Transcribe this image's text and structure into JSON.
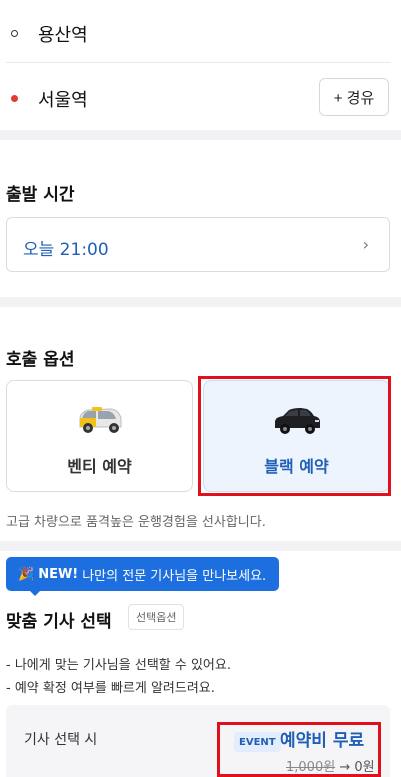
{
  "route": {
    "origin": "용산역",
    "destination": "서울역",
    "via_button": "+ 경유"
  },
  "departure": {
    "title": "출발 시간",
    "time": "오늘 21:00",
    "chevron": "›"
  },
  "call_options": {
    "title": "호출 옵션",
    "venti_label": "벤티 예약",
    "black_label": "블랙 예약",
    "description": "고급 차량으로 품격높은 운행경험을 선사합니다."
  },
  "new_banner": {
    "badge": "NEW!",
    "text": "나만의 전문 기사님을 만나보세요.",
    "icon": "party-popper-icon"
  },
  "driver_select": {
    "title": "맞춤 기사 선택",
    "tag": "선택옵션",
    "bullets": [
      "- 나에게 맞는 기사님을 선택할 수 있어요.",
      "- 예약 확정 여부를 빠르게 알려드려요."
    ]
  },
  "pricing": {
    "label": "기사 선택 시",
    "event_badge": "EVENT",
    "free_text": "예약비 무료",
    "old_price": "1,000원",
    "arrow": "→",
    "new_price": "0원"
  },
  "colors": {
    "accent_blue": "#1f5fb8",
    "banner_blue": "#1d6fe0",
    "highlight_red": "#e0101c",
    "destination_dot": "#e23b2e"
  }
}
